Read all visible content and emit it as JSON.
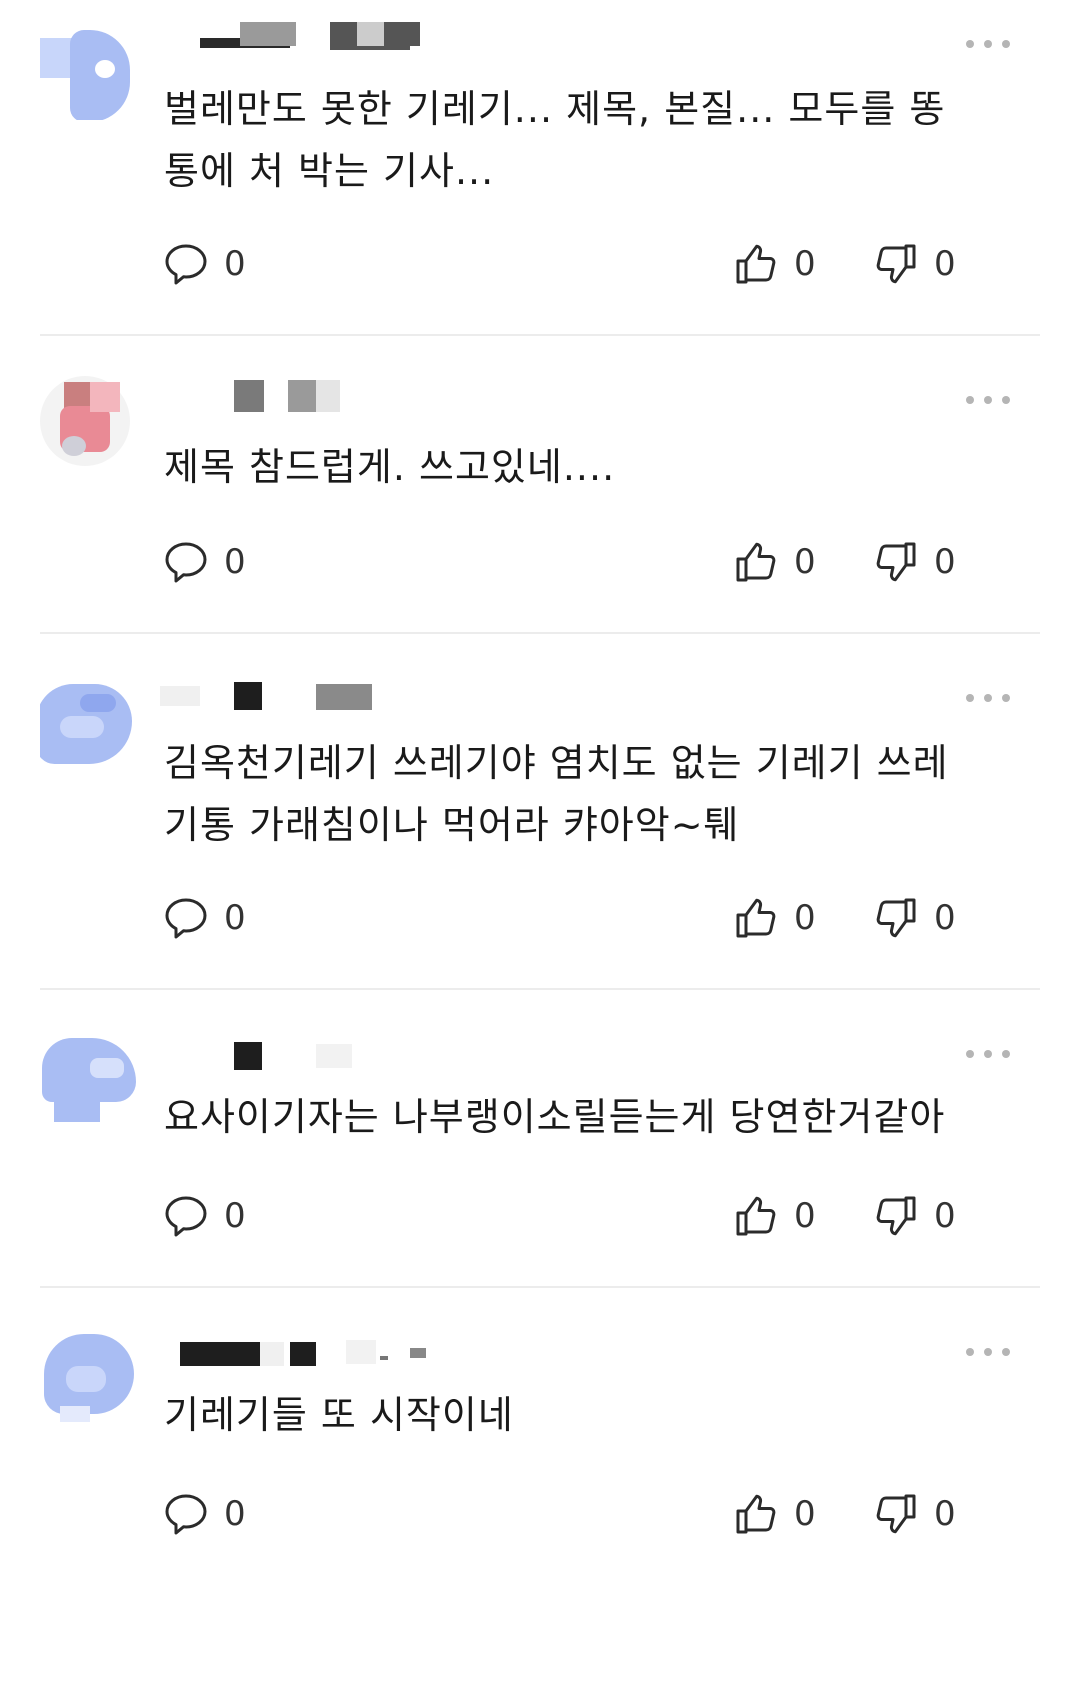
{
  "comments": [
    {
      "text": "벌레만도 못한 기레기... 제목, 본질... 모두를 똥통에 처 박는 기사...",
      "reply_count": "0",
      "like_count": "0",
      "dislike_count": "0",
      "icons": {
        "reply": "speech-bubble-icon",
        "like": "thumbs-up-icon",
        "dislike": "thumbs-down-icon",
        "more": "more-dots-icon"
      }
    },
    {
      "text": "제목 참드럽게. 쓰고있네....",
      "reply_count": "0",
      "like_count": "0",
      "dislike_count": "0"
    },
    {
      "text": "김옥천기레기 쓰레기야 염치도 없는 기레기 쓰레기통 가래침이나 먹어라 캬아악~퉤",
      "reply_count": "0",
      "like_count": "0",
      "dislike_count": "0"
    },
    {
      "text": "요사이기자는 나부랭이소릴듣는게 당연한거같아",
      "reply_count": "0",
      "like_count": "0",
      "dislike_count": "0"
    },
    {
      "text": "기레기들 또 시작이네",
      "reply_count": "0",
      "like_count": "0",
      "dislike_count": "0"
    }
  ],
  "colors": {
    "icon": "#2b2b2b",
    "divider": "#ececec",
    "avatar_blue": "#a9bdf3",
    "avatar_pink": "#e98a95",
    "mosaic_dark": "#1e1e1e",
    "mosaic_gray": "#8a8a8a"
  }
}
